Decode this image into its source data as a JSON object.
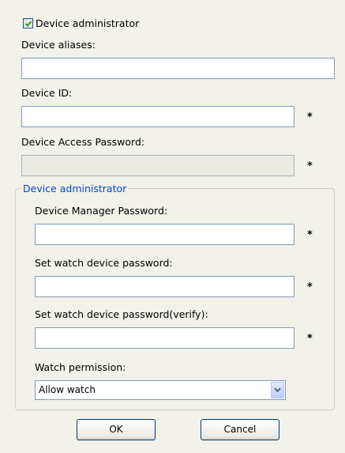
{
  "device_admin_checkbox": {
    "label": "Device administrator",
    "checked": true
  },
  "device_aliases": {
    "label": "Device aliases:",
    "value": ""
  },
  "device_id": {
    "label": "Device ID:",
    "value": "",
    "required_mark": "*"
  },
  "device_access_password": {
    "label": "Device Access Password:",
    "value": "",
    "required_mark": "*",
    "disabled": true
  },
  "admin_group": {
    "title": "Device administrator",
    "manager_password": {
      "label": "Device Manager Password:",
      "value": "",
      "required_mark": "*"
    },
    "watch_password": {
      "label": "Set watch device password:",
      "value": "",
      "required_mark": "*"
    },
    "watch_password_verify": {
      "label": "Set watch device password(verify):",
      "value": "",
      "required_mark": "*"
    },
    "watch_permission": {
      "label": "Watch permission:",
      "selected": "Allow watch"
    }
  },
  "buttons": {
    "ok": "OK",
    "cancel": "Cancel"
  },
  "colors": {
    "background": "#f2f1ea",
    "group_title": "#0046d5",
    "field_border": "#7f9db9",
    "checkmark": "#21a121"
  },
  "icons": {
    "check": "check-icon",
    "dropdown": "chevron-down-icon"
  }
}
